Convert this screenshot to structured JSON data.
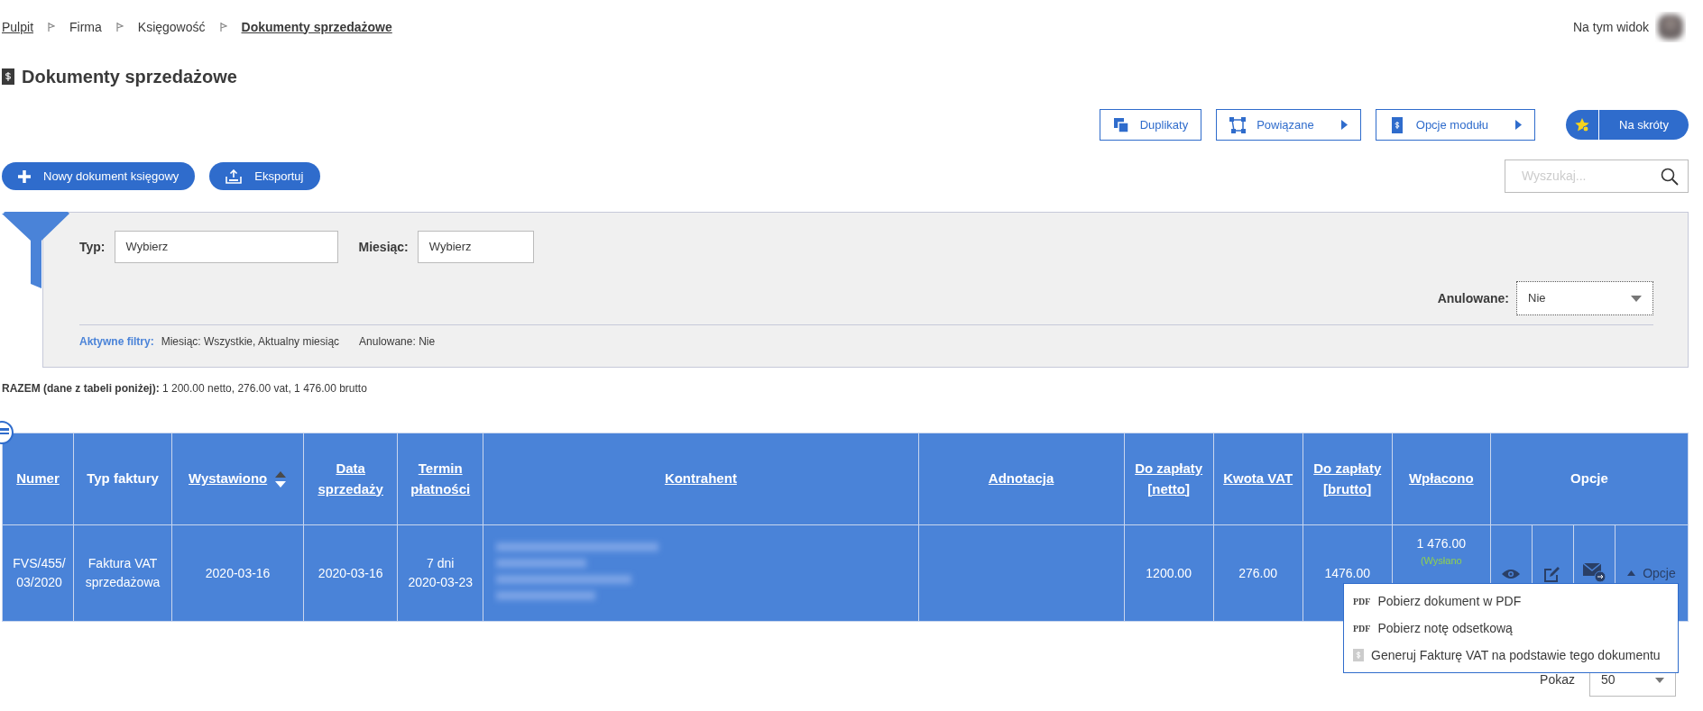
{
  "breadcrumb": [
    {
      "label": "Pulpit",
      "current": false,
      "link": true
    },
    {
      "label": "Firma",
      "current": false,
      "link": false
    },
    {
      "label": "Księgowość",
      "current": false,
      "link": false
    },
    {
      "label": "Dokumenty sprzedażowe",
      "current": true,
      "link": true
    }
  ],
  "user": {
    "label": "Na tym widok"
  },
  "page_title": "Dokumenty sprzedażowe",
  "toolbar": [
    {
      "label": "Duplikaty",
      "kind": "duplicates"
    },
    {
      "label": "Powiązane",
      "kind": "related"
    },
    {
      "label": "Opcje modułu",
      "kind": "module"
    },
    {
      "label": "Na skróty",
      "kind": "shortcuts"
    }
  ],
  "actions": [
    {
      "label": "Nowy dokument księgowy",
      "kind": "add"
    },
    {
      "label": "Eksportuj",
      "kind": "export"
    }
  ],
  "search": {
    "placeholder": "Wyszukaj..."
  },
  "filters": {
    "fields": [
      {
        "label": "Typ:",
        "value": "Wybierz"
      },
      {
        "label": "Miesiąc:",
        "value": "Wybierz"
      }
    ],
    "cancelled": {
      "label": "Anulowane:",
      "value": "Nie"
    },
    "active_label": "Aktywne filtry:",
    "active": [
      "Miesiąc: Wszystkie, Aktualny miesiąc",
      "Anulowane: Nie"
    ]
  },
  "totals": "**RAZEM (dane z tabeli poniżej):** 1 200.00 netto, 276.00 vat, 1 476.00 brutto",
  "table": {
    "columns": [
      {
        "label": "Numer",
        "sortable": true,
        "sorted": false
      },
      {
        "label": "Typ faktury",
        "sortable": false,
        "sorted": false
      },
      {
        "label": "Wystawiono",
        "sortable": true,
        "sorted": true
      },
      {
        "label": "Data sprzedaży",
        "sortable": true,
        "sorted": false
      },
      {
        "label": "Termin płatności",
        "sortable": true,
        "sorted": false
      },
      {
        "label": "Kontrahent",
        "sortable": true,
        "sorted": false
      },
      {
        "label": "Adnotacja",
        "sortable": true,
        "sorted": false
      },
      {
        "label": "Do zapłaty [netto]",
        "sortable": true,
        "sorted": false
      },
      {
        "label": "Kwota VAT",
        "sortable": true,
        "sorted": false
      },
      {
        "label": "Do zapłaty [brutto]",
        "sortable": true,
        "sorted": false
      },
      {
        "label": "Wpłacono",
        "sortable": true,
        "sorted": false
      },
      {
        "label": "Opcje",
        "sortable": false,
        "sorted": false
      }
    ],
    "rows": [
      {
        "number": "FVS/455/03/2020",
        "type": "Faktura VAT sprzedażowa",
        "issued": "2020-03-16",
        "sale_date": "2020-03-16",
        "due_days": "7 dni",
        "due_date": "2020-03-23",
        "net": "1200.00",
        "vat": "276.00",
        "gross": "1476.00",
        "paid": "1 476.00",
        "paid_note": "(Wysłano",
        "options_label": "Opcje"
      }
    ]
  },
  "options_menu": [
    {
      "label": "Pobierz dokument w PDF",
      "kind": "pdf",
      "tag": "PDF"
    },
    {
      "label": "Pobierz notę odsetkową",
      "kind": "pdf",
      "tag": "PDF"
    },
    {
      "label": "Generuj Fakturę VAT na podstawie tego dokumentu",
      "kind": "document"
    }
  ],
  "page_size": {
    "label": "Pokaz",
    "value": "50"
  }
}
